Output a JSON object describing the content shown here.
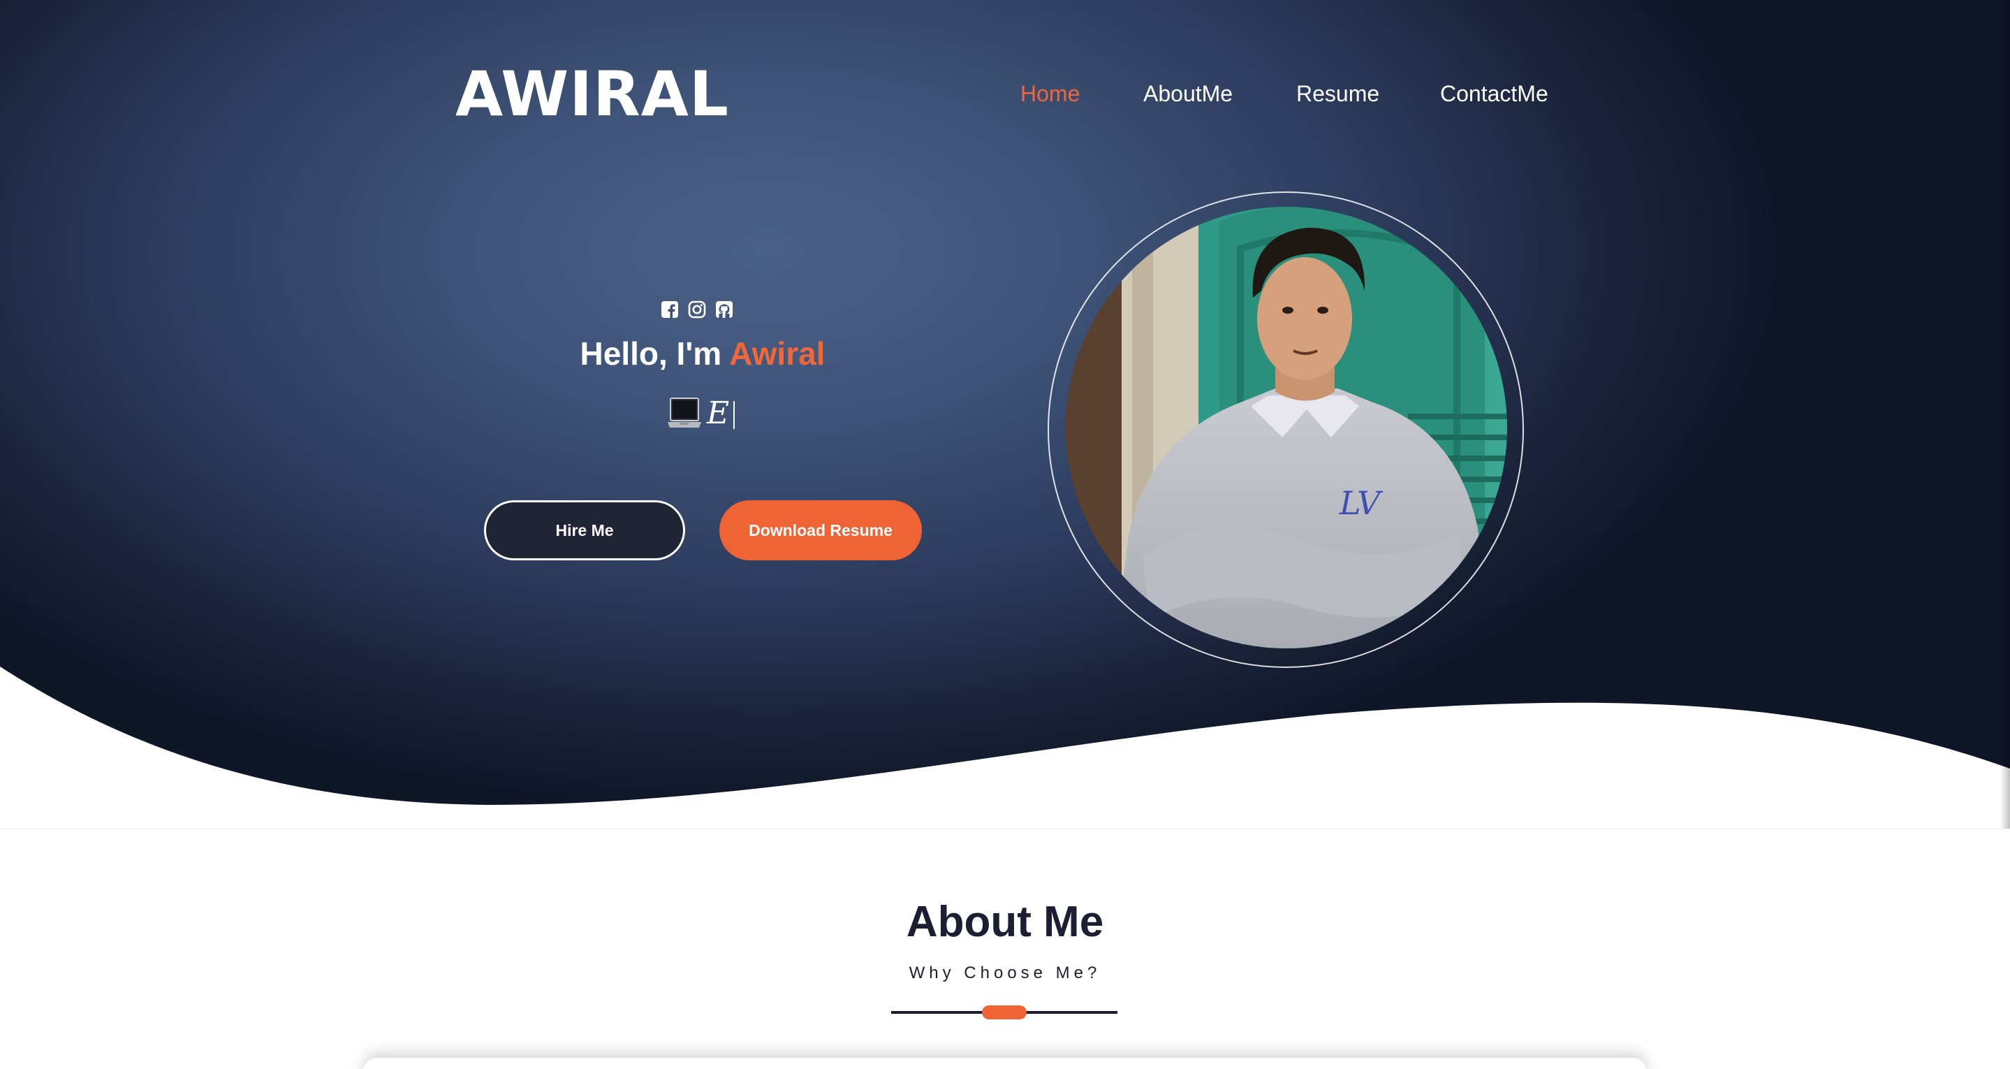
{
  "brand": {
    "logo_text": "AWIRAL"
  },
  "nav": {
    "items": [
      {
        "label": "Home",
        "active": true
      },
      {
        "label": "AboutMe",
        "active": false
      },
      {
        "label": "Resume",
        "active": false
      },
      {
        "label": "ContactMe",
        "active": false
      }
    ]
  },
  "hero": {
    "social_icons": [
      "facebook-icon",
      "instagram-icon",
      "github-icon"
    ],
    "greeting_prefix": "Hello, I'm ",
    "greeting_name": "Awiral",
    "typed_emoji": "laptop-icon",
    "typed_text": "E",
    "buttons": {
      "hire": "Hire Me",
      "download": "Download Resume"
    }
  },
  "about": {
    "title": "About Me",
    "subtitle": "Why Choose Me?"
  },
  "colors": {
    "accent": "#ef6335",
    "dark": "#1c1f33",
    "hero_bg": "#3d5276"
  }
}
